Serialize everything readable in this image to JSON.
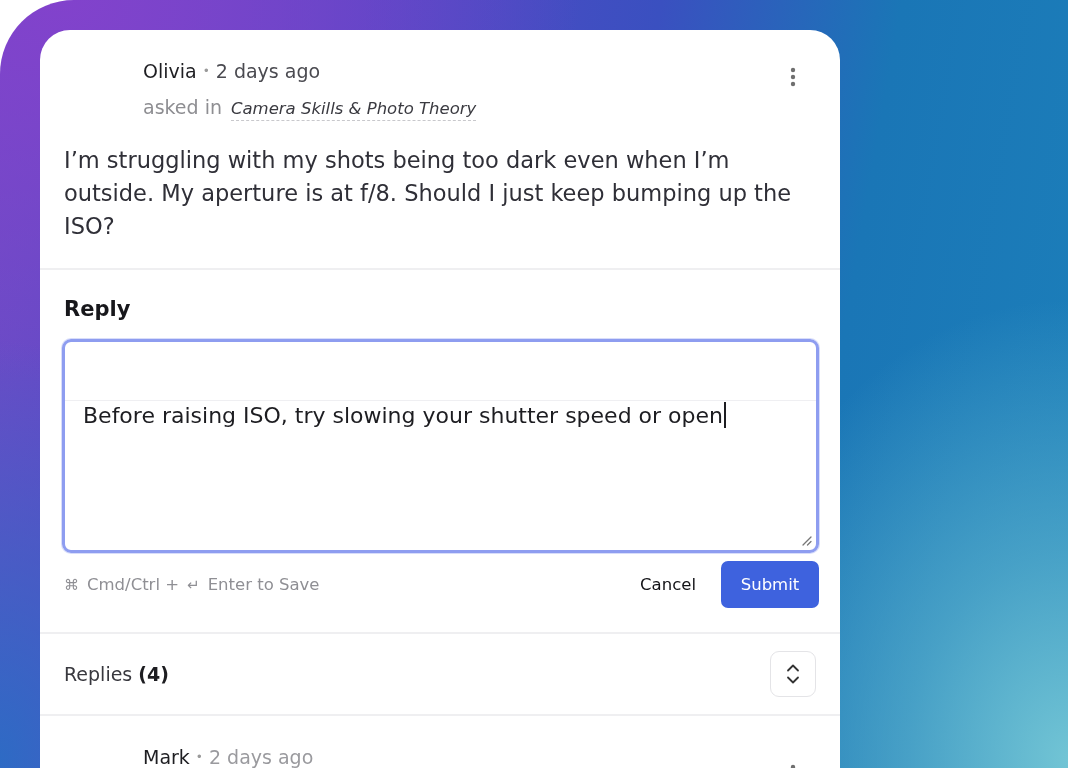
{
  "question": {
    "author": "Olivia",
    "separator": "•",
    "time": "2 days ago",
    "asked_in": "asked in",
    "category": "Camera Skills & Photo Theory",
    "body": "I’m struggling with my shots being too dark even when I’m outside. My aperture is at f/8. Should I just keep bumping up the ISO?"
  },
  "reply_editor": {
    "heading": "Reply",
    "value": "Before raising ISO, try slowing your shutter speed or open",
    "focused": true,
    "shortcut_hint": [
      {
        "symbol": "⌘",
        "text": "Cmd/Ctrl +"
      },
      {
        "symbol": "↵",
        "text": "Enter to Save"
      }
    ],
    "buttons": [
      {
        "kind": "text",
        "label": "Cancel"
      },
      {
        "kind": "primary",
        "label": "Submit"
      }
    ]
  },
  "replies": {
    "heading": "Replies **(4)**",
    "items": [
      {
        "author": "Mark",
        "separator": "•",
        "time": "2 days ago"
      }
    ]
  }
}
